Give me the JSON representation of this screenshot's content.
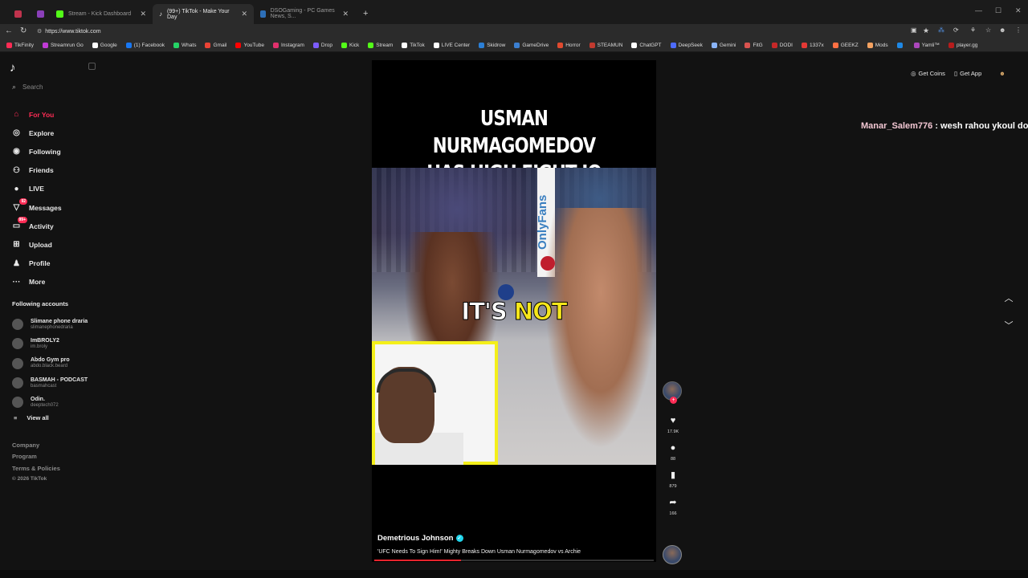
{
  "browser": {
    "tabs": [
      {
        "title": "",
        "color": "#c0334d"
      },
      {
        "title": "",
        "color": "#8a3fb8"
      },
      {
        "title": "Stream - Kick Dashboard",
        "color": "#53fc18"
      },
      {
        "title": "(99+) TikTok - Make Your Day",
        "color": "#ffffff"
      },
      {
        "title": "DSOGaming - PC Games News, S...",
        "color": "#2d6fb8"
      }
    ],
    "url": "https://www.tiktok.com",
    "bookmarks": [
      {
        "label": "TikFinity",
        "color": "#fe2c55"
      },
      {
        "label": "Streamrun Go",
        "color": "#c13bd6"
      },
      {
        "label": "Google",
        "color": "#ffffff"
      },
      {
        "label": "(1) Facebook",
        "color": "#1877f2"
      },
      {
        "label": "Whats",
        "color": "#25d366"
      },
      {
        "label": "Gmail",
        "color": "#ea4335"
      },
      {
        "label": "YouTube",
        "color": "#ff0000"
      },
      {
        "label": "Instagram",
        "color": "#e1306c"
      },
      {
        "label": "Drop",
        "color": "#7c5cff"
      },
      {
        "label": "Kick",
        "color": "#53fc18"
      },
      {
        "label": "Stream",
        "color": "#53fc18"
      },
      {
        "label": "TikTok",
        "color": "#ffffff"
      },
      {
        "label": "LIVE Center",
        "color": "#ffffff"
      },
      {
        "label": "Skidrow",
        "color": "#2b7fd6"
      },
      {
        "label": "GameDrive",
        "color": "#3b7fd0"
      },
      {
        "label": "Horror",
        "color": "#e04a2f"
      },
      {
        "label": "STEAMUN",
        "color": "#c23a2f"
      },
      {
        "label": "ChatGPT",
        "color": "#ffffff"
      },
      {
        "label": "DeepSeek",
        "color": "#4d6bfe"
      },
      {
        "label": "Gemini",
        "color": "#8ab4f8"
      },
      {
        "label": "FitG",
        "color": "#d9534f"
      },
      {
        "label": "DODI",
        "color": "#c62828"
      },
      {
        "label": "1337x",
        "color": "#e53935"
      },
      {
        "label": "GEEKZ",
        "color": "#ff7043"
      },
      {
        "label": "Mods",
        "color": "#f4a261"
      },
      {
        "label": "",
        "color": "#1e88e5"
      },
      {
        "label": "Yamli™",
        "color": "#ab47bc"
      },
      {
        "label": "player.gg",
        "color": "#b71c1c"
      }
    ]
  },
  "sidebar": {
    "search_placeholder": "Search",
    "nav": [
      {
        "label": "For You",
        "icon": "home-icon",
        "glyph": "⌂",
        "active": true,
        "badge": ""
      },
      {
        "label": "Explore",
        "icon": "compass-icon",
        "glyph": "◎",
        "active": false,
        "badge": ""
      },
      {
        "label": "Following",
        "icon": "following-icon",
        "glyph": "◉",
        "active": false,
        "badge": ""
      },
      {
        "label": "Friends",
        "icon": "friends-icon",
        "glyph": "⚇",
        "active": false,
        "badge": ""
      },
      {
        "label": "LIVE",
        "icon": "live-icon",
        "glyph": "●",
        "active": false,
        "badge": ""
      },
      {
        "label": "Messages",
        "icon": "messages-icon",
        "glyph": "▽",
        "active": false,
        "badge": "92"
      },
      {
        "label": "Activity",
        "icon": "activity-icon",
        "glyph": "▭",
        "active": false,
        "badge": "99+"
      },
      {
        "label": "Upload",
        "icon": "upload-icon",
        "glyph": "⊞",
        "active": false,
        "badge": ""
      },
      {
        "label": "Profile",
        "icon": "profile-icon",
        "glyph": "♟",
        "active": false,
        "badge": ""
      },
      {
        "label": "More",
        "icon": "more-icon",
        "glyph": "···",
        "active": false,
        "badge": ""
      }
    ],
    "following_title": "Following accounts",
    "accounts": [
      {
        "name": "Slimane phone draria",
        "handle": "slimanephonedraria"
      },
      {
        "name": "ImBROLY2",
        "handle": "im.broly"
      },
      {
        "name": "Abdo Gym pro",
        "handle": "abdo.black.beard"
      },
      {
        "name": "BASMAH - PODCAST",
        "handle": "basmahcast"
      },
      {
        "name": "Odin.",
        "handle": "deeptech072"
      }
    ],
    "view_all": "View all",
    "footer": [
      "Company",
      "Program",
      "Terms & Policies"
    ],
    "copyright": "© 2026 TikTok"
  },
  "header": {
    "get_coins": "Get Coins",
    "get_app": "Get App"
  },
  "chat": {
    "user": "Manar_Salem776",
    "message": " : wesh rahou ykoul doka"
  },
  "video": {
    "headline_line1": "USMAN NURMAGOMEDOV",
    "headline_line2": "HAS HIGH FIGHT IQ",
    "banner": "OnlyFans",
    "caption_white": "IT'S",
    "caption_yellow": "NOT",
    "author": "Demetrious Johnson",
    "description": "'UFC Needs To Sign Him!' Mighty Breaks Down Usman Nurmagomedov vs Archie",
    "progress": 0.31
  },
  "actions": {
    "likes": "17.9K",
    "comments": "88",
    "saves": "879",
    "shares": "166"
  },
  "colors": {
    "accent": "#fe2c55",
    "caption_yellow": "#f6e71b",
    "progress": "#e8242d"
  }
}
